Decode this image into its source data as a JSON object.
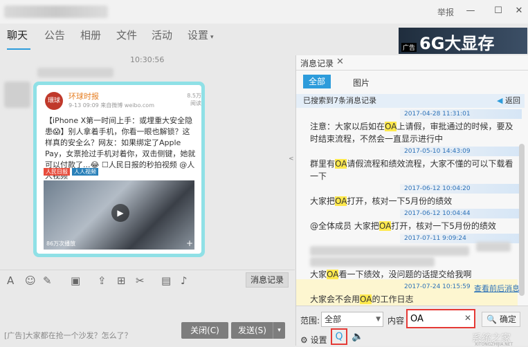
{
  "titlebar": {
    "report": "举报",
    "min": "—",
    "max": "☐",
    "close": "✕"
  },
  "nav": {
    "tabs": [
      "聊天",
      "公告",
      "相册",
      "文件",
      "活动",
      "设置"
    ],
    "settings_caret": "▾"
  },
  "ad": {
    "tag": "广告",
    "text": "6G大显存"
  },
  "chat": {
    "time": "10:30:56",
    "card": {
      "logo": "環球",
      "source": "环球时报",
      "meta": "9-13 09:09  来自微博  weibo.com",
      "count": "8.5万 阅读",
      "body": "【iPhone X第一时间上手：或埋重大安全隐患😱】别人拿着手机，你看一眼也解锁？这样真的安全么？网友：如果绑定了Apple Pay，女票抢过手机对着你，双击侧键，她就可以付款了...😂 ☐人民日报的秒拍视频 @人人视频",
      "tag1": "人民日报",
      "tag2": "人人视频",
      "views": "86万次播放",
      "play": "▶",
      "plus": "+"
    }
  },
  "toolbar": {
    "history_button": "消息记录"
  },
  "input": {
    "ad_line": "[广告]大家都在抢一个沙发？怎么了？",
    "close_button": "关闭(C)",
    "send_button": "发送(S)",
    "send_caret": "▾"
  },
  "history": {
    "tab_title": "消息记录",
    "filter_all": "全部",
    "filter_pic": "图片",
    "found": "已搜索到7条消息记录",
    "back": "返回",
    "records": [
      {
        "ts": "2017-04-28 11:31:01",
        "pre": "注意：大家以后如在",
        "hl": "OA",
        "post": "上请假，审批通过的时候，要及时结束流程，不然会一直显示进行中"
      },
      {
        "ts": "2017-05-10 14:43:09",
        "pre": "群里有",
        "hl": "OA",
        "post": "请假流程和绩效流程，大家不懂的可以下载看一下"
      },
      {
        "ts": "2017-06-12 10:04:20",
        "pre": "大家把",
        "hl": "OA",
        "post": "打开，核对一下5月份的绩效"
      },
      {
        "ts": "2017-06-12 10:04:44",
        "pre": "@全体成员 大家把",
        "hl": "OA",
        "post": "打开，核对一下5月份的绩效"
      },
      {
        "ts": "2017-07-11 9:09:24",
        "pre": "大家",
        "hl": "OA",
        "post": "看一下绩效，没问题的话提交给我啊"
      },
      {
        "ts": "2017-07-24 10:15:59",
        "pre": "大家会不会用",
        "hl": "OA",
        "post": "的工作日志"
      }
    ],
    "see_context": "查看前后消息",
    "range_label": "范围:",
    "range_value": "全部",
    "content_label": "内容",
    "search_value": "OA",
    "ok_button": "确定",
    "settings": "设置",
    "watermark": "系统之家",
    "watermark_sub": "XITONGZHIJIA.NET"
  }
}
